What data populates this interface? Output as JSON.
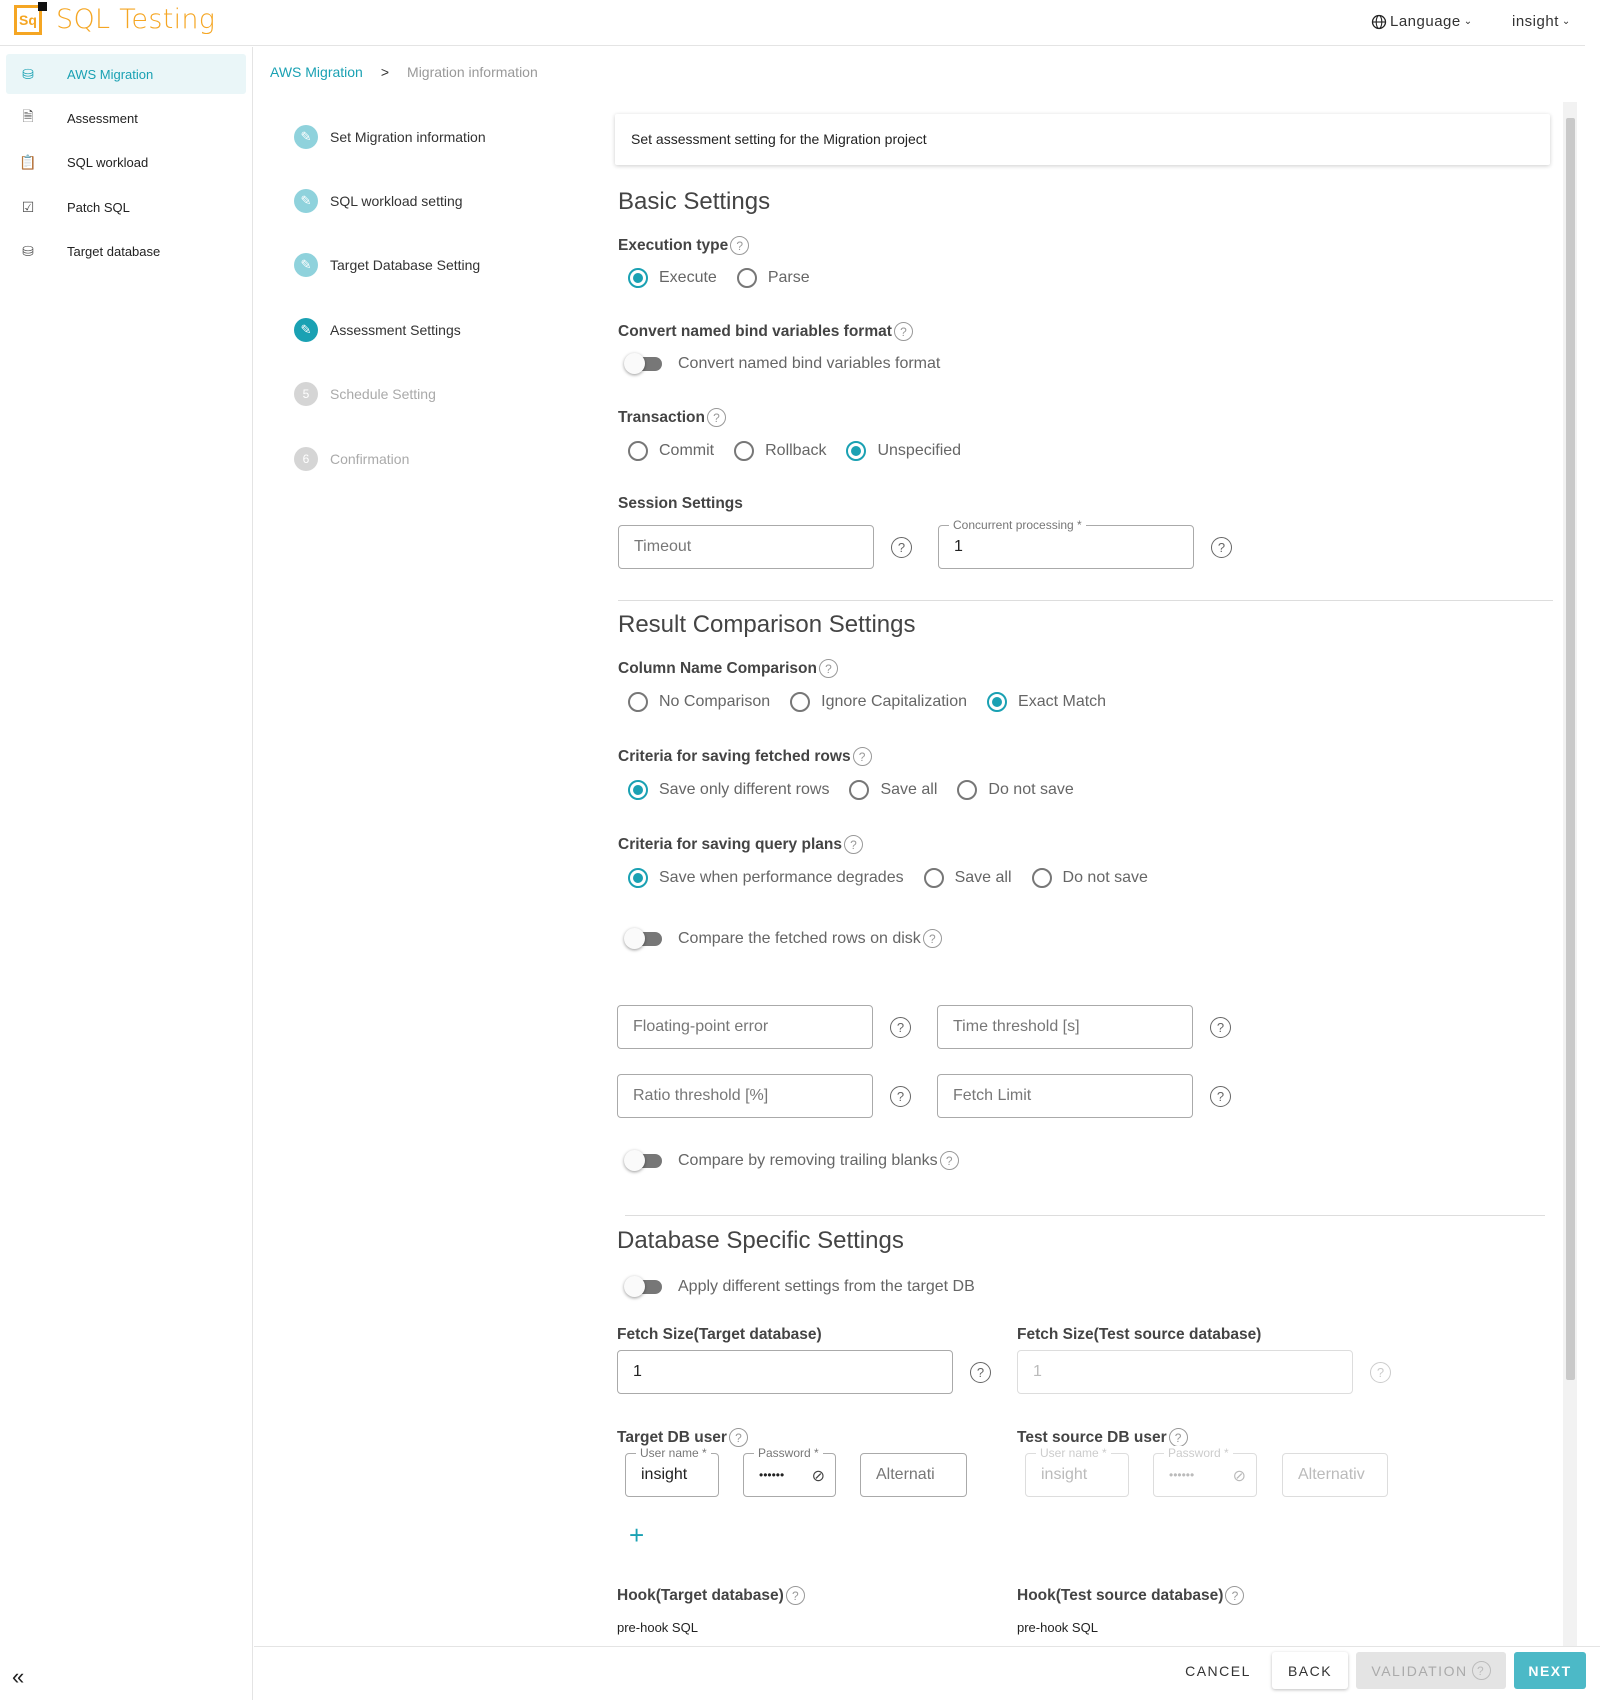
{
  "app": {
    "name": "SQL Testing",
    "logo_text": "Sq"
  },
  "topbar": {
    "language_label": "Language",
    "user_label": "insight"
  },
  "sidebar": {
    "items": [
      {
        "label": "AWS Migration",
        "icon": "migration-icon"
      },
      {
        "label": "Assessment",
        "icon": "document-icon"
      },
      {
        "label": "SQL workload",
        "icon": "clipboard-icon"
      },
      {
        "label": "Patch SQL",
        "icon": "clipboard-check-icon"
      },
      {
        "label": "Target database",
        "icon": "database-icon"
      }
    ]
  },
  "breadcrumb": {
    "root": "AWS Migration",
    "separator": ">",
    "current": "Migration information"
  },
  "steps": [
    {
      "label": "Set Migration information",
      "num": "✎"
    },
    {
      "label": "SQL workload setting",
      "num": "✎"
    },
    {
      "label": "Target Database Setting",
      "num": "✎"
    },
    {
      "label": "Assessment Settings",
      "num": "✎"
    },
    {
      "label": "Schedule Setting",
      "num": "5"
    },
    {
      "label": "Confirmation",
      "num": "6"
    }
  ],
  "intro": "Set assessment setting for the Migration project",
  "basic": {
    "title": "Basic Settings",
    "execution_type": {
      "label": "Execution type",
      "options": [
        "Execute",
        "Parse"
      ],
      "selected": "Execute"
    },
    "convert_bind": {
      "label": "Convert named bind variables format",
      "toggle_label": "Convert named bind variables format"
    },
    "transaction": {
      "label": "Transaction",
      "options": [
        "Commit",
        "Rollback",
        "Unspecified"
      ],
      "selected": "Unspecified"
    },
    "session": {
      "label": "Session Settings",
      "timeout_placeholder": "Timeout",
      "concurrent_label": "Concurrent processing *",
      "concurrent_value": "1"
    }
  },
  "result": {
    "title": "Result Comparison Settings",
    "column_name": {
      "label": "Column Name Comparison",
      "options": [
        "No Comparison",
        "Ignore Capitalization",
        "Exact Match"
      ],
      "selected": "Exact Match"
    },
    "fetched_rows": {
      "label": "Criteria for saving fetched rows",
      "options": [
        "Save only different rows",
        "Save all",
        "Do not save"
      ],
      "selected": "Save only different rows"
    },
    "query_plans": {
      "label": "Criteria for saving query plans",
      "options": [
        "Save when performance degrades",
        "Save all",
        "Do not save"
      ],
      "selected": "Save when performance degrades"
    },
    "compare_disk": "Compare the fetched rows on disk",
    "floating_placeholder": "Floating-point error",
    "time_placeholder": "Time threshold [s]",
    "ratio_placeholder": "Ratio threshold [%]",
    "fetch_limit_placeholder": "Fetch Limit",
    "trailing_blanks": "Compare by removing trailing blanks"
  },
  "dbspecific": {
    "title": "Database Specific Settings",
    "apply_different": "Apply different settings from the target DB",
    "fetch_target_label": "Fetch Size(Target database)",
    "fetch_target_value": "1",
    "fetch_source_label": "Fetch Size(Test source database)",
    "fetch_source_value": "1",
    "target_user_label": "Target DB user",
    "source_user_label": "Test source DB user",
    "username_label": "User name *",
    "password_label": "Password *",
    "username_value": "insight",
    "password_mask": "••••••",
    "alt_target": "Alternati",
    "alt_source": "Alternativ",
    "hook_target_label": "Hook(Target database)",
    "hook_source_label": "Hook(Test source database)",
    "prehook": "pre-hook SQL"
  },
  "footer": {
    "cancel": "CANCEL",
    "back": "BACK",
    "validation": "VALIDATION",
    "next": "NEXT"
  },
  "colors": {
    "accent": "#1aa1b3",
    "brand": "#f5a623"
  }
}
